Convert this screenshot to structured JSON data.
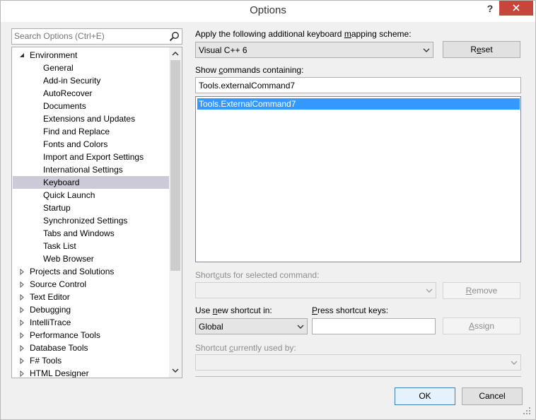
{
  "window": {
    "title": "Options"
  },
  "titlebar": {
    "help_label": "?"
  },
  "search": {
    "placeholder": "Search Options (Ctrl+E)"
  },
  "tree": [
    {
      "label": "Environment",
      "level": 0,
      "state": "expanded"
    },
    {
      "label": "General",
      "level": 1
    },
    {
      "label": "Add-in Security",
      "level": 1
    },
    {
      "label": "AutoRecover",
      "level": 1
    },
    {
      "label": "Documents",
      "level": 1
    },
    {
      "label": "Extensions and Updates",
      "level": 1
    },
    {
      "label": "Find and Replace",
      "level": 1
    },
    {
      "label": "Fonts and Colors",
      "level": 1
    },
    {
      "label": "Import and Export Settings",
      "level": 1
    },
    {
      "label": "International Settings",
      "level": 1
    },
    {
      "label": "Keyboard",
      "level": 1,
      "selected": true
    },
    {
      "label": "Quick Launch",
      "level": 1
    },
    {
      "label": "Startup",
      "level": 1
    },
    {
      "label": "Synchronized Settings",
      "level": 1
    },
    {
      "label": "Tabs and Windows",
      "level": 1
    },
    {
      "label": "Task List",
      "level": 1
    },
    {
      "label": "Web Browser",
      "level": 1
    },
    {
      "label": "Projects and Solutions",
      "level": 0,
      "state": "collapsed"
    },
    {
      "label": "Source Control",
      "level": 0,
      "state": "collapsed"
    },
    {
      "label": "Text Editor",
      "level": 0,
      "state": "collapsed"
    },
    {
      "label": "Debugging",
      "level": 0,
      "state": "collapsed"
    },
    {
      "label": "IntelliTrace",
      "level": 0,
      "state": "collapsed"
    },
    {
      "label": "Performance Tools",
      "level": 0,
      "state": "collapsed"
    },
    {
      "label": "Database Tools",
      "level": 0,
      "state": "collapsed"
    },
    {
      "label": "F# Tools",
      "level": 0,
      "state": "collapsed"
    },
    {
      "label": "HTML Designer",
      "level": 0,
      "state": "collapsed"
    }
  ],
  "keyboard": {
    "scheme_label": {
      "before": "Apply the following additional keyboard ",
      "key": "m",
      "after": "apping scheme:"
    },
    "scheme_value": "Visual C++ 6",
    "reset_label": {
      "before": "R",
      "key": "e",
      "after": "set"
    },
    "show_commands_label": {
      "before": "Show ",
      "key": "c",
      "after": "ommands containing:"
    },
    "command_filter": "Tools.externalCommand7",
    "commands": [
      "Tools.ExternalCommand7"
    ],
    "shortcuts_label": {
      "before": "Short",
      "key": "c",
      "after": "uts for selected command:"
    },
    "shortcuts_value": "",
    "remove_label": {
      "before": "",
      "key": "R",
      "after": "emove"
    },
    "use_shortcut_label": {
      "before": "Use ",
      "key": "n",
      "after": "ew shortcut in:"
    },
    "use_shortcut_value": "Global",
    "press_keys_label": {
      "before": "",
      "key": "P",
      "after": "ress shortcut keys:"
    },
    "press_keys_value": "",
    "assign_label": {
      "before": "",
      "key": "A",
      "after": "ssign"
    },
    "used_by_label": {
      "before": "Shortcut ",
      "key": "c",
      "after": "urrently used by:"
    },
    "used_by_value": ""
  },
  "footer": {
    "ok_label": "OK",
    "cancel_label": "Cancel"
  },
  "colors": {
    "selection": "#3399ff",
    "tree_selected": "#cbcbd8",
    "close_button": "#c7463b"
  }
}
